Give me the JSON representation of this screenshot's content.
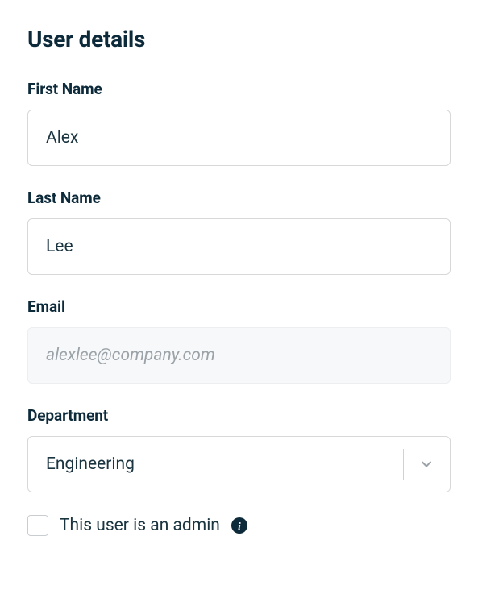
{
  "title": "User details",
  "fields": {
    "firstName": {
      "label": "First Name",
      "value": "Alex"
    },
    "lastName": {
      "label": "Last Name",
      "value": "Lee"
    },
    "email": {
      "label": "Email",
      "value": "alexlee@company.com"
    },
    "department": {
      "label": "Department",
      "value": "Engineering"
    }
  },
  "adminCheckbox": {
    "label": "This user is an admin",
    "checked": false
  }
}
